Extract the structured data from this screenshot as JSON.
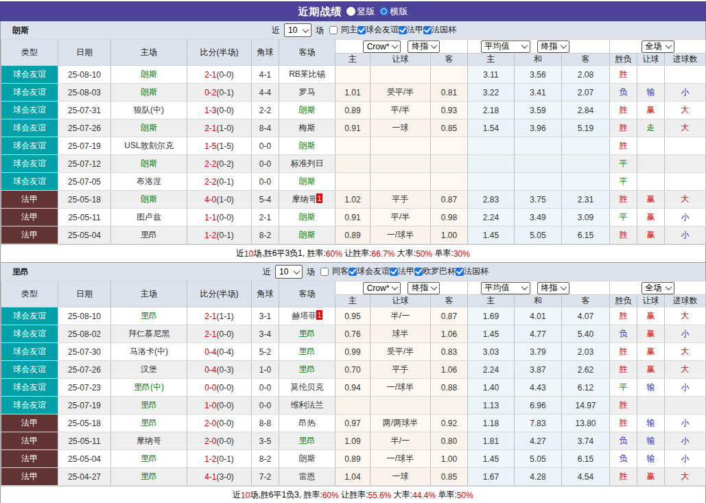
{
  "colors": {
    "purple": "#4d4299",
    "accent_blue": "#1a73e8",
    "panel_bg": "#dce3ed",
    "teal": "#00a0a8",
    "maroon": "#623333",
    "team_green": "#008000",
    "score_red": "#cc0000",
    "res_red": "#d60000",
    "res_green": "#158a15",
    "res_blue": "#2a2ad8"
  },
  "titlebar": {
    "title": "近期战绩",
    "radios": [
      {
        "label": "竖版",
        "checked": false
      },
      {
        "label": "横版",
        "checked": true
      }
    ]
  },
  "columns": {
    "left": [
      "类型",
      "日期",
      "主场",
      "比分(半场)",
      "角球",
      "客场"
    ],
    "groups": [
      {
        "selects": [
          "Crow*",
          "终指"
        ],
        "subs": [
          "主",
          "让球",
          "客"
        ]
      },
      {
        "selects": [
          "平均值",
          "终指"
        ],
        "subs": [
          "主",
          "和",
          "客"
        ]
      },
      {
        "selects": [
          "全场"
        ],
        "subs": [
          "胜负",
          "让球",
          "进球数"
        ]
      }
    ]
  },
  "result_roles": {
    "胜": "r",
    "赢": "r",
    "大": "r",
    "平": "g",
    "走": "g",
    "负": "b",
    "输": "b",
    "小": "b"
  },
  "type_colors": {
    "球会友谊": "#00a0a8",
    "法甲": "#623333"
  },
  "tables": [
    {
      "team": "朗斯",
      "filter": {
        "prefix": "近",
        "count": "10",
        "suffix": "场",
        "venue_check": {
          "label": "同主",
          "checked": false
        },
        "competitions": [
          {
            "label": "球会友谊",
            "checked": true
          },
          {
            "label": "法甲",
            "checked": true
          },
          {
            "label": "法国杯",
            "checked": true
          }
        ]
      },
      "rows": [
        {
          "type": "球会友谊",
          "date": "25-08-10",
          "home": "朗斯",
          "hh": true,
          "hs": "",
          "score": "2-1",
          "half": "(0-0)",
          "corner": "4-1",
          "away": "RB莱比锡",
          "ah": false,
          "as": "",
          "o1": "",
          "oh": "",
          "o2": "",
          "a1": "3.11",
          "ax": "3.56",
          "a2": "2.08",
          "res": "胜",
          "hc": "",
          "gl": ""
        },
        {
          "type": "球会友谊",
          "date": "25-08-03",
          "home": "朗斯",
          "hh": true,
          "hs": "",
          "score": "0-2",
          "half": "(0-1)",
          "corner": "4-4",
          "away": "罗马",
          "ah": false,
          "as": "",
          "o1": "1.01",
          "oh": "受平/半",
          "o2": "0.81",
          "a1": "3.22",
          "ax": "3.41",
          "a2": "2.07",
          "res": "负",
          "hc": "输",
          "gl": "小"
        },
        {
          "type": "球会友谊",
          "date": "25-07-31",
          "home": "狼队(中)",
          "hh": false,
          "hs": "",
          "score": "1-3",
          "half": "(0-0)",
          "corner": "2-2",
          "away": "朗斯",
          "ah": true,
          "as": "",
          "o1": "0.89",
          "oh": "平/半",
          "o2": "0.93",
          "a1": "2.18",
          "ax": "3.59",
          "a2": "2.84",
          "res": "胜",
          "hc": "赢",
          "gl": "大"
        },
        {
          "type": "球会友谊",
          "date": "25-07-26",
          "home": "朗斯",
          "hh": true,
          "hs": "",
          "score": "2-1",
          "half": "(1-0)",
          "corner": "8-4",
          "away": "梅斯",
          "ah": false,
          "as": "",
          "o1": "0.91",
          "oh": "一球",
          "o2": "0.85",
          "a1": "1.54",
          "ax": "3.96",
          "a2": "5.19",
          "res": "胜",
          "hc": "走",
          "gl": "大"
        },
        {
          "type": "球会友谊",
          "date": "25-07-19",
          "home": "USL敦刻尔克",
          "hh": false,
          "hs": "",
          "score": "1-5",
          "half": "(1-5)",
          "corner": "0-0",
          "away": "朗斯",
          "ah": true,
          "as": "",
          "o1": "",
          "oh": "",
          "o2": "",
          "a1": "",
          "ax": "",
          "a2": "",
          "res": "胜",
          "hc": "",
          "gl": ""
        },
        {
          "type": "球会友谊",
          "date": "25-07-12",
          "home": "朗斯",
          "hh": true,
          "hs": "",
          "score": "2-2",
          "half": "(0-2)",
          "corner": "0-0",
          "away": "标准列日",
          "ah": false,
          "as": "",
          "o1": "",
          "oh": "",
          "o2": "",
          "a1": "",
          "ax": "",
          "a2": "",
          "res": "平",
          "hc": "",
          "gl": ""
        },
        {
          "type": "球会友谊",
          "date": "25-07-05",
          "home": "布洛涅",
          "hh": false,
          "hs": "",
          "score": "2-2",
          "half": "(0-1)",
          "corner": "0-0",
          "away": "朗斯",
          "ah": true,
          "as": "",
          "o1": "",
          "oh": "",
          "o2": "",
          "a1": "",
          "ax": "",
          "a2": "",
          "res": "平",
          "hc": "",
          "gl": ""
        },
        {
          "type": "法甲",
          "date": "25-05-18",
          "home": "朗斯",
          "hh": true,
          "hs": "",
          "score": "4-0",
          "half": "(1-0)",
          "corner": "5-4",
          "away": "摩纳哥",
          "ah": false,
          "as": "1",
          "o1": "1.02",
          "oh": "平手",
          "o2": "0.87",
          "a1": "2.83",
          "ax": "3.75",
          "a2": "2.31",
          "res": "胜",
          "hc": "赢",
          "gl": "大"
        },
        {
          "type": "法甲",
          "date": "25-05-11",
          "home": "图卢兹",
          "hh": false,
          "hs": "",
          "score": "1-1",
          "half": "(0-0)",
          "corner": "2-1",
          "away": "朗斯",
          "ah": true,
          "as": "",
          "o1": "0.91",
          "oh": "平/半",
          "o2": "0.98",
          "a1": "2.24",
          "ax": "3.49",
          "a2": "3.09",
          "res": "平",
          "hc": "赢",
          "gl": "小"
        },
        {
          "type": "法甲",
          "date": "25-05-04",
          "home": "里昂",
          "hh": false,
          "hs": "",
          "score": "1-2",
          "half": "(0-1)",
          "corner": "8-2",
          "away": "朗斯",
          "ah": true,
          "as": "",
          "o1": "0.89",
          "oh": "一/球半",
          "o2": "1.00",
          "a1": "1.45",
          "ax": "5.05",
          "a2": "6.15",
          "res": "胜",
          "hc": "赢",
          "gl": "小"
        }
      ],
      "summary": [
        {
          "text": "近",
          "red": false
        },
        {
          "text": "10",
          "red": true
        },
        {
          "text": "场,胜6平3负1, 胜率:",
          "red": false
        },
        {
          "text": "60%",
          "red": true
        },
        {
          "text": " 让胜率:",
          "red": false
        },
        {
          "text": "66.7%",
          "red": true
        },
        {
          "text": " 大率:",
          "red": false
        },
        {
          "text": "50%",
          "red": true
        },
        {
          "text": " 单率:",
          "red": false
        },
        {
          "text": "30%",
          "red": true
        }
      ]
    },
    {
      "team": "里昂",
      "filter": {
        "prefix": "近",
        "count": "10",
        "suffix": "场",
        "venue_check": {
          "label": "同客",
          "checked": false
        },
        "competitions": [
          {
            "label": "球会友谊",
            "checked": true
          },
          {
            "label": "法甲",
            "checked": true
          },
          {
            "label": "欧罗巴杯",
            "checked": true
          },
          {
            "label": "法国杯",
            "checked": true
          }
        ]
      },
      "rows": [
        {
          "type": "球会友谊",
          "date": "25-08-10",
          "home": "里昂",
          "hh": true,
          "hs": "",
          "score": "2-1",
          "half": "(1-1)",
          "corner": "3-1",
          "away": "赫塔菲",
          "ah": false,
          "as": "1",
          "o1": "0.95",
          "oh": "半/一",
          "o2": "0.87",
          "a1": "1.69",
          "ax": "4.01",
          "a2": "4.07",
          "res": "胜",
          "hc": "赢",
          "gl": "大"
        },
        {
          "type": "球会友谊",
          "date": "25-08-02",
          "home": "拜仁慕尼黑",
          "hh": false,
          "hs": "",
          "score": "2-1",
          "half": "(0-0)",
          "corner": "3-4",
          "away": "里昂",
          "ah": true,
          "as": "",
          "o1": "0.76",
          "oh": "球半",
          "o2": "1.06",
          "a1": "1.45",
          "ax": "4.77",
          "a2": "5.40",
          "res": "负",
          "hc": "赢",
          "gl": "小"
        },
        {
          "type": "球会友谊",
          "date": "25-07-30",
          "home": "马洛卡(中)",
          "hh": false,
          "hs": "",
          "score": "0-4",
          "half": "(0-4)",
          "corner": "5-2",
          "away": "里昂",
          "ah": true,
          "as": "",
          "o1": "0.99",
          "oh": "受平/半",
          "o2": "0.83",
          "a1": "3.03",
          "ax": "3.79",
          "a2": "2.03",
          "res": "胜",
          "hc": "赢",
          "gl": "大"
        },
        {
          "type": "球会友谊",
          "date": "25-07-26",
          "home": "汉堡",
          "hh": false,
          "hs": "",
          "score": "0-4",
          "half": "(0-3)",
          "corner": "1-0",
          "away": "里昂",
          "ah": true,
          "as": "",
          "o1": "0.70",
          "oh": "平手",
          "o2": "1.06",
          "a1": "2.24",
          "ax": "3.87",
          "a2": "2.62",
          "res": "胜",
          "hc": "赢",
          "gl": "大"
        },
        {
          "type": "球会友谊",
          "date": "25-07-23",
          "home": "里昂(中)",
          "hh": true,
          "hs": "",
          "score": "0-0",
          "half": "(0-0)",
          "corner": "0-0",
          "away": "莫伦贝克",
          "ah": false,
          "as": "",
          "o1": "0.94",
          "oh": "一/球半",
          "o2": "0.88",
          "a1": "1.40",
          "ax": "4.43",
          "a2": "6.12",
          "res": "平",
          "hc": "输",
          "gl": "小"
        },
        {
          "type": "球会友谊",
          "date": "25-07-19",
          "home": "里昂",
          "hh": true,
          "hs": "",
          "score": "1-0",
          "half": "(0-0)",
          "corner": "0-0",
          "away": "维利法兰",
          "ah": false,
          "as": "",
          "o1": "",
          "oh": "",
          "o2": "",
          "a1": "1.13",
          "ax": "6.96",
          "a2": "14.97",
          "res": "胜",
          "hc": "",
          "gl": ""
        },
        {
          "type": "法甲",
          "date": "25-05-18",
          "home": "里昂",
          "hh": true,
          "hs": "",
          "score": "2-0",
          "half": "(0-0)",
          "corner": "8-8",
          "away": "昂热",
          "ah": false,
          "as": "",
          "o1": "0.97",
          "oh": "两/两球半",
          "o2": "0.92",
          "a1": "1.18",
          "ax": "7.83",
          "a2": "13.80",
          "res": "胜",
          "hc": "输",
          "gl": "小"
        },
        {
          "type": "法甲",
          "date": "25-05-11",
          "home": "摩纳哥",
          "hh": false,
          "hs": "",
          "score": "2-0",
          "half": "(0-0)",
          "corner": "3-5",
          "away": "里昂",
          "ah": true,
          "as": "",
          "o1": "1.09",
          "oh": "半/一",
          "o2": "0.80",
          "a1": "1.81",
          "ax": "4.27",
          "a2": "3.74",
          "res": "负",
          "hc": "输",
          "gl": "小"
        },
        {
          "type": "法甲",
          "date": "25-05-04",
          "home": "里昂",
          "hh": true,
          "hs": "",
          "score": "1-2",
          "half": "(0-1)",
          "corner": "8-2",
          "away": "朗斯",
          "ah": false,
          "as": "",
          "o1": "0.89",
          "oh": "一/球半",
          "o2": "1.00",
          "a1": "1.45",
          "ax": "5.05",
          "a2": "6.15",
          "res": "负",
          "hc": "输",
          "gl": "小"
        },
        {
          "type": "法甲",
          "date": "25-04-27",
          "home": "里昂",
          "hh": true,
          "hs": "",
          "score": "4-1",
          "half": "(3-0)",
          "corner": "7-2",
          "away": "雷恩",
          "ah": false,
          "as": "",
          "o1": "1.04",
          "oh": "一球",
          "o2": "0.85",
          "a1": "1.67",
          "ax": "4.28",
          "a2": "4.54",
          "res": "胜",
          "hc": "赢",
          "gl": "大"
        }
      ],
      "summary": [
        {
          "text": "近",
          "red": false
        },
        {
          "text": "10",
          "red": true
        },
        {
          "text": "场,胜6平1负3, 胜率:",
          "red": false
        },
        {
          "text": "60%",
          "red": true
        },
        {
          "text": " 让胜率:",
          "red": false
        },
        {
          "text": "55.6%",
          "red": true
        },
        {
          "text": " 大率:",
          "red": false
        },
        {
          "text": "44.4%",
          "red": true
        },
        {
          "text": " 单率:",
          "red": false
        },
        {
          "text": "50%",
          "red": true
        }
      ]
    }
  ]
}
